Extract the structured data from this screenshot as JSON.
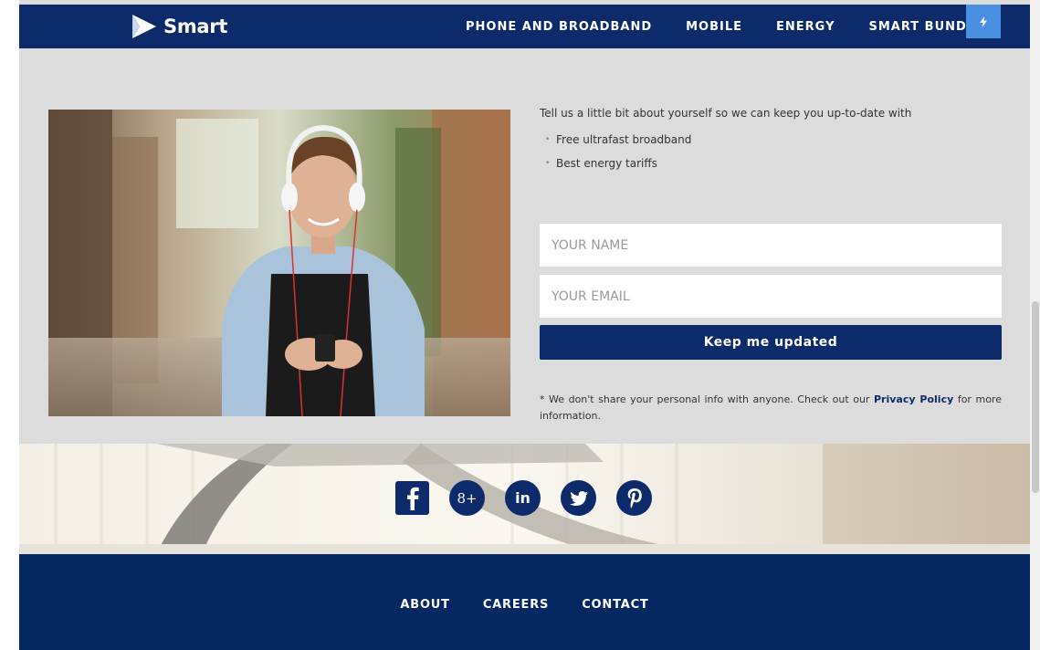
{
  "header": {
    "logo_text": "Smart",
    "nav": [
      "PHONE AND BROADBAND",
      "MOBILE",
      "ENERGY",
      "SMART BUNDLE"
    ],
    "bolt_icon": "lightning-icon"
  },
  "signup": {
    "intro": "Tell us a little bit about yourself so we can keep you up-to-date with",
    "bullets": [
      "Free ultrafast broadband",
      "Best energy tariffs"
    ],
    "name_placeholder": "YOUR NAME",
    "email_placeholder": "YOUR EMAIL",
    "submit_label": "Keep me updated",
    "disclaimer_before": "* We don't share your personal info with anyone. Check out our ",
    "privacy_link": "Privacy Policy",
    "disclaimer_after": " for more information."
  },
  "social": {
    "icons": [
      "facebook-icon",
      "google-plus-icon",
      "linkedin-icon",
      "twitter-icon",
      "pinterest-icon"
    ],
    "google_plus_glyph": "8+",
    "linkedin_glyph": "in"
  },
  "footer": {
    "links": [
      "ABOUT",
      "CAREERS",
      "CONTACT"
    ]
  },
  "colors": {
    "brand_navy": "#0d2a6b",
    "accent_blue": "#4a90e2",
    "panel_gray": "#dcdcdc"
  }
}
